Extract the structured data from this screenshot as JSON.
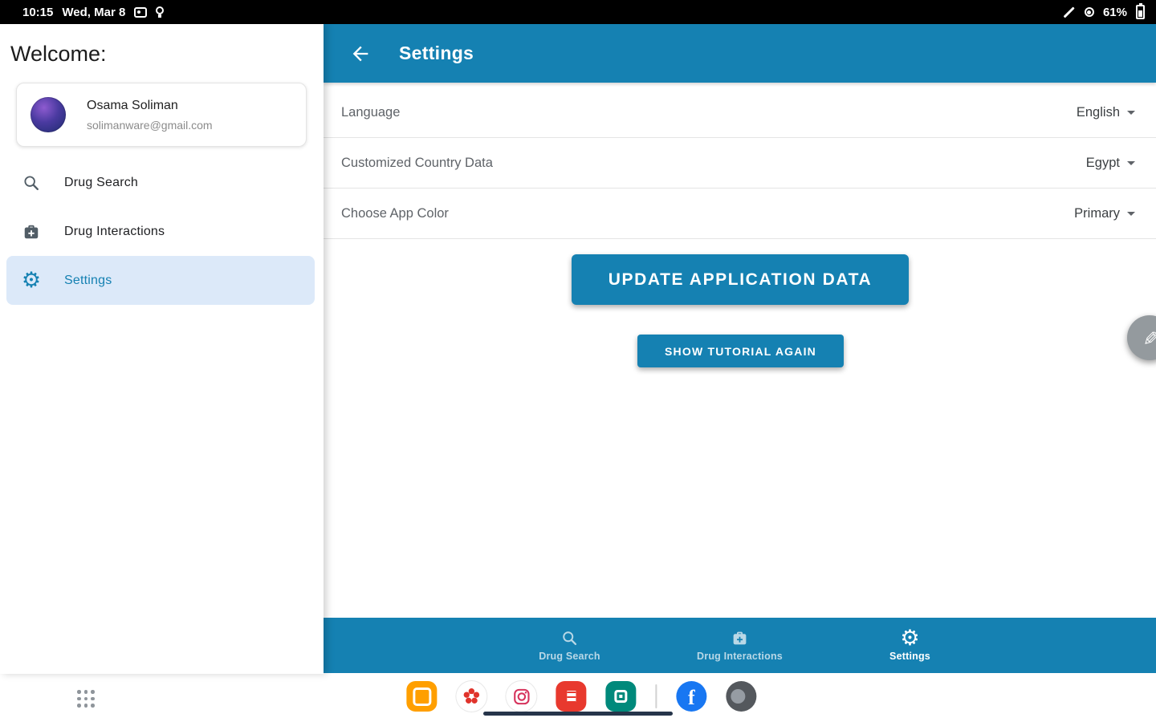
{
  "status_bar": {
    "time": "10:15",
    "date": "Wed, Mar 8",
    "battery_percent": "61%"
  },
  "sidebar": {
    "welcome": "Welcome:",
    "user": {
      "name": "Osama Soliman",
      "email": "solimanware@gmail.com"
    },
    "items": [
      {
        "label": "Drug Search",
        "icon": "search-icon"
      },
      {
        "label": "Drug Interactions",
        "icon": "medical-bag-icon"
      },
      {
        "label": "Settings",
        "icon": "gear-icon"
      }
    ]
  },
  "header": {
    "title": "Settings"
  },
  "settings": {
    "rows": [
      {
        "label": "Language",
        "value": "English"
      },
      {
        "label": "Customized Country Data",
        "value": "Egypt"
      },
      {
        "label": "Choose App Color",
        "value": "Primary"
      }
    ],
    "update_button": "UPDATE APPLICATION DATA",
    "tutorial_button": "SHOW TUTORIAL AGAIN"
  },
  "bottom_nav": {
    "items": [
      {
        "label": "Drug Search",
        "active": false
      },
      {
        "label": "Drug Interactions",
        "active": false
      },
      {
        "label": "Settings",
        "active": true
      }
    ]
  },
  "taskbar": {
    "apps": [
      "folder",
      "gallery",
      "instagram",
      "notes",
      "memo",
      "facebook",
      "browser"
    ]
  },
  "colors": {
    "primary": "#1581b2",
    "sidebar_active_bg": "#dce9f9",
    "status_bar_bg": "#000000"
  }
}
